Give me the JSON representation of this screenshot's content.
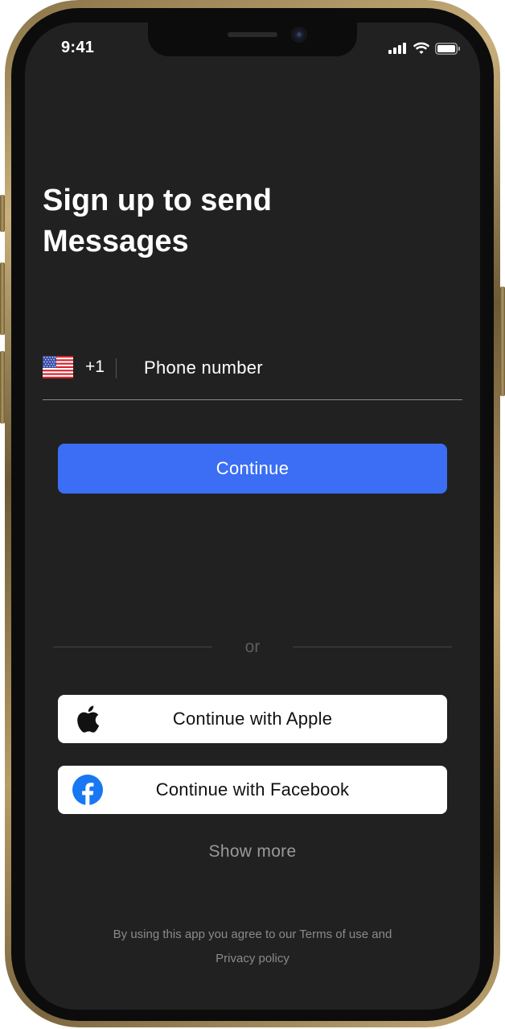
{
  "status_bar": {
    "time": "9:41",
    "icons": [
      "cellular-signal-icon",
      "wifi-icon",
      "battery-icon"
    ]
  },
  "header": {
    "title_line1": "Sign up to send",
    "title_line2": "Messages"
  },
  "phone_field": {
    "country_flag_icon": "us-flag-icon",
    "dial_code": "+1",
    "placeholder": "Phone number",
    "value": ""
  },
  "primary": {
    "continue_label": "Continue"
  },
  "divider": {
    "or_label": "or"
  },
  "social": {
    "apple_label": "Continue with Apple",
    "apple_icon": "apple-logo-icon",
    "facebook_label": "Continue with Facebook",
    "facebook_icon": "facebook-logo-icon"
  },
  "show_more_label": "Show more",
  "legal": {
    "prefix": "By using this app you agree to our",
    "terms_label": "Terms of use",
    "conjunction": "and",
    "privacy_label": "Privacy policy"
  },
  "colors": {
    "background": "#212121",
    "accent": "#3b6ef5",
    "facebook": "#1877f2",
    "frame_gold": "#b89c66"
  }
}
